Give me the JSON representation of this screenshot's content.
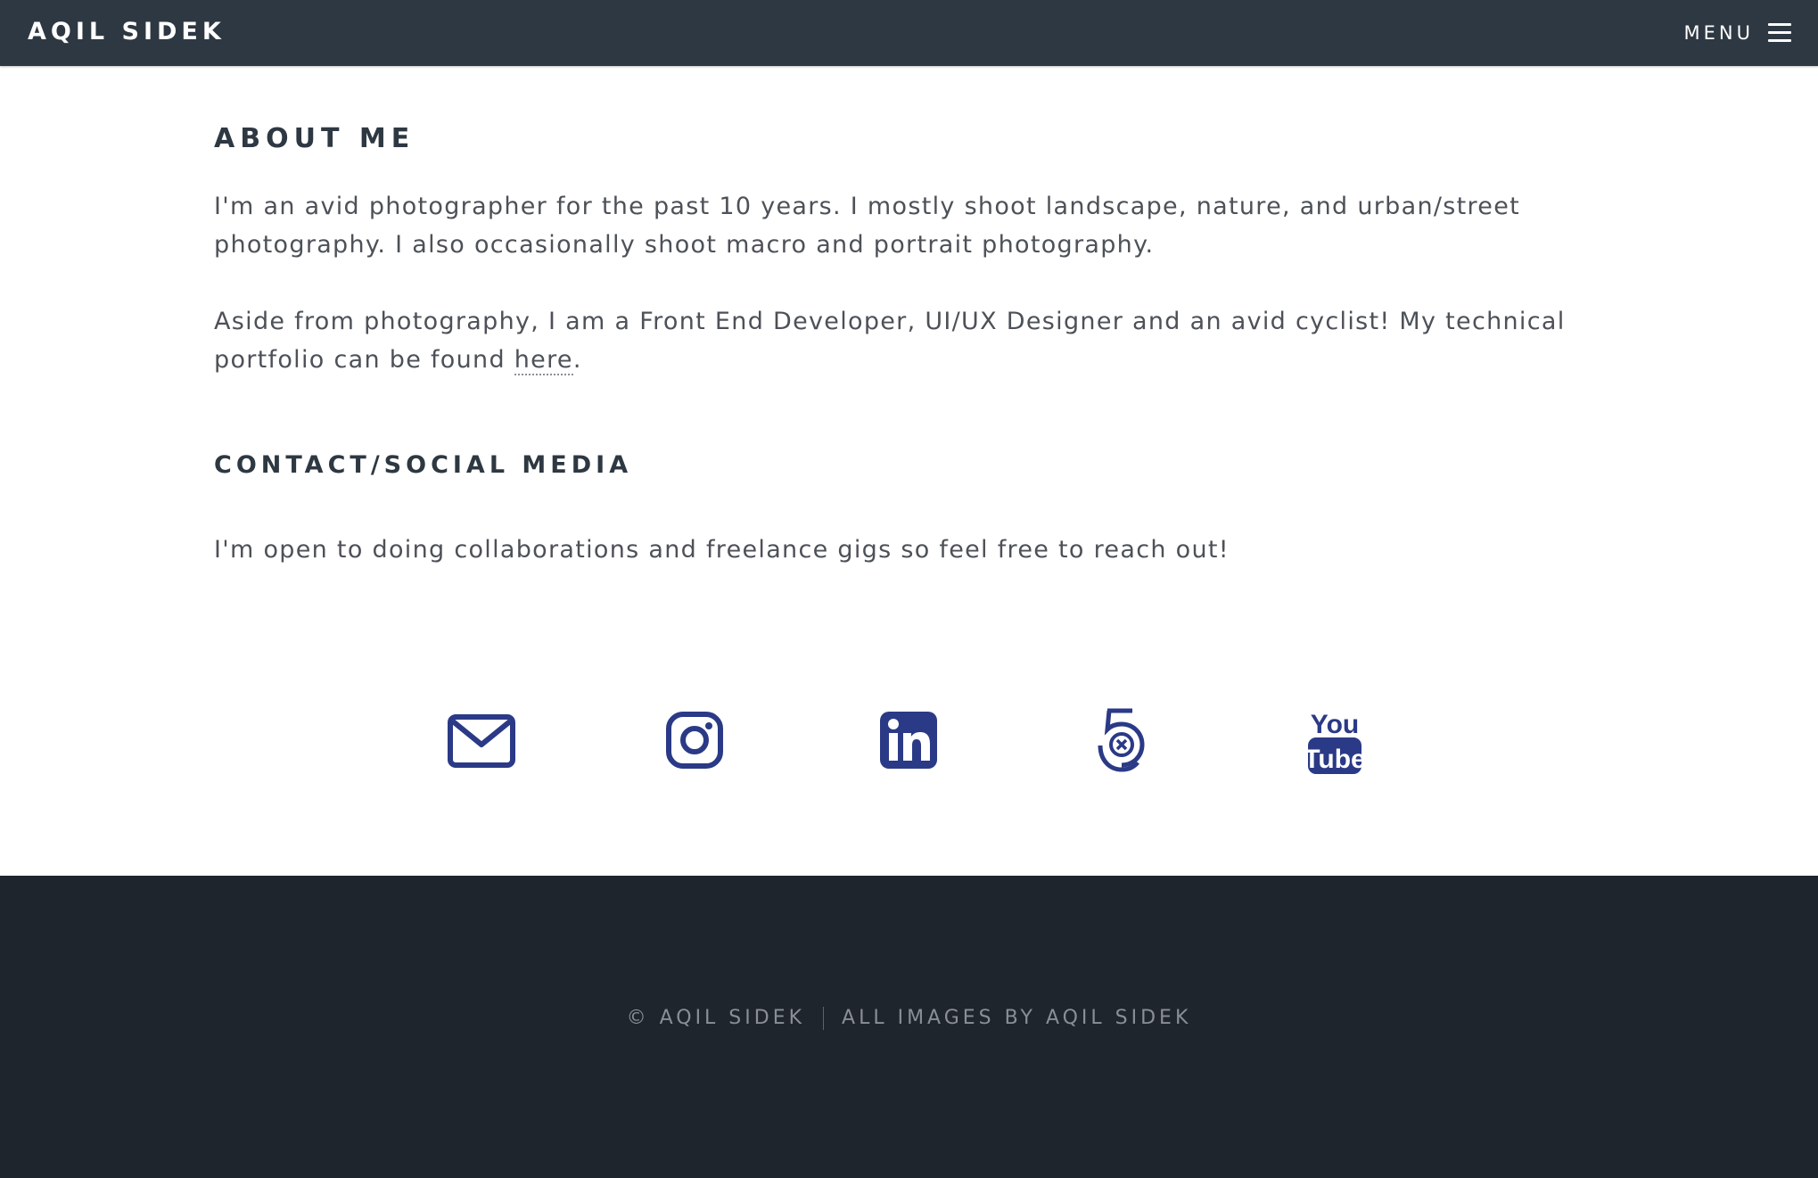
{
  "header": {
    "brand": "AQIL SIDEK",
    "menu_label": "MENU"
  },
  "about": {
    "heading": "ABOUT ME",
    "paragraph1": "I'm an avid photographer for the past 10 years. I mostly shoot landscape, nature, and urban/street photography. I also occasionally shoot macro and portrait photography.",
    "paragraph2_before_link": "Aside from photography, I am a Front End Developer, UI/UX Designer and an avid cyclist! My technical portfolio can be found ",
    "paragraph2_link": "here",
    "paragraph2_after_link": "."
  },
  "contact": {
    "heading": "CONTACT/SOCIAL MEDIA",
    "paragraph": "I'm open to doing collaborations and freelance gigs so feel free to reach out!",
    "icon_color": "#2b3a86",
    "social_icons": [
      "envelope-icon",
      "instagram-icon",
      "linkedin-icon",
      "500px-icon",
      "youtube-icon"
    ]
  },
  "footer": {
    "copyright": "© AQIL SIDEK",
    "credit": "ALL IMAGES BY AQIL SIDEK"
  },
  "colors": {
    "topbar": "#2e3842",
    "footer": "#1f252d",
    "heading": "#2e3842",
    "body_text": "#4d5158"
  }
}
